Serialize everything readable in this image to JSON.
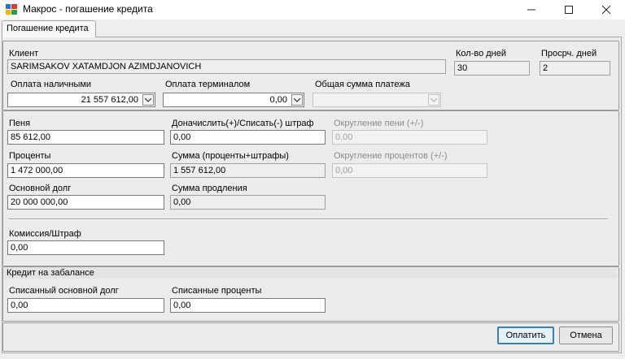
{
  "window": {
    "title": "Макрос - погашение кредита"
  },
  "tabs": [
    {
      "label": "Погашение кредита"
    }
  ],
  "client": {
    "label": "Клиент",
    "value": "SARIMSAKOV XATAMDJON AZIMDJANOVICH",
    "days_label": "Кол-во дней",
    "days_value": "30",
    "overdue_label": "Просрч. дней",
    "overdue_value": "2"
  },
  "payment": {
    "cash_label": "Оплата наличными",
    "cash_value": "21 557 612,00",
    "terminal_label": "Оплата терминалом",
    "terminal_value": "0,00",
    "total_label": "Общая сумма платежа",
    "total_value": ""
  },
  "charges": {
    "penalty_label": "Пеня",
    "penalty_value": "85 612,00",
    "adjust_label": "Доначислить(+)/Списать(-) штраф",
    "adjust_value": "0,00",
    "penalty_round_label": "Округление пени (+/-)",
    "penalty_round_value": "0,00",
    "interest_label": "Проценты",
    "interest_value": "1 472 000,00",
    "sum_label": "Сумма (проценты+штрафы)",
    "sum_value": "1 557 612,00",
    "interest_round_label": "Округление процентов (+/-)",
    "interest_round_value": "0,00",
    "principal_label": "Основной долг",
    "principal_value": "20 000 000,00",
    "extension_label": "Сумма продления",
    "extension_value": "0,00",
    "commission_label": "Комиссия/Штраф",
    "commission_value": "0,00"
  },
  "offbalance": {
    "title": "Кредит на забалансе",
    "written_principal_label": "Списанный основной долг",
    "written_principal_value": "0,00",
    "written_interest_label": "Списанные проценты",
    "written_interest_value": "0,00"
  },
  "buttons": {
    "pay": "Оплатить",
    "cancel": "Отмена"
  }
}
